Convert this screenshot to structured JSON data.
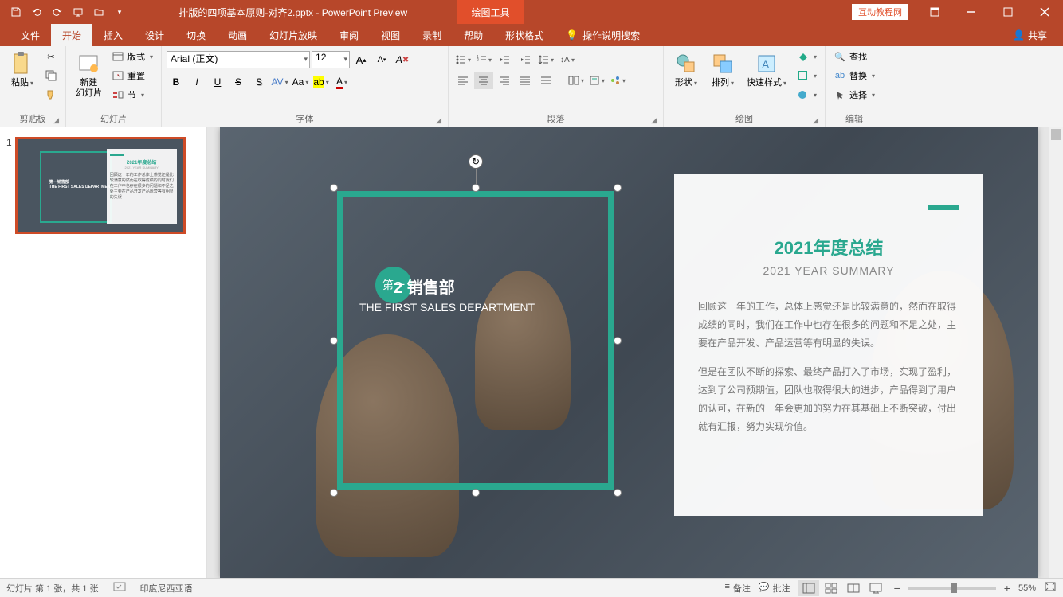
{
  "titlebar": {
    "docTitle": "排版的四项基本原则-对齐2.pptx - PowerPoint Preview",
    "contextTab": "绘图工具",
    "tutorialLink": "互动教程网"
  },
  "tabs": {
    "file": "文件",
    "home": "开始",
    "insert": "插入",
    "design": "设计",
    "transitions": "切换",
    "animations": "动画",
    "slideshow": "幻灯片放映",
    "review": "审阅",
    "view": "视图",
    "record": "录制",
    "help": "帮助",
    "shapeFormat": "形状格式",
    "tellMe": "操作说明搜索",
    "share": "共享"
  },
  "ribbon": {
    "clipboard": {
      "label": "剪贴板",
      "paste": "粘贴"
    },
    "slides": {
      "label": "幻灯片",
      "newSlide": "新建\n幻灯片",
      "layout": "版式",
      "reset": "重置",
      "section": "节"
    },
    "font": {
      "label": "字体",
      "fontName": "Arial (正文)",
      "fontSize": "12"
    },
    "paragraph": {
      "label": "段落"
    },
    "drawing": {
      "label": "绘图",
      "shapes": "形状",
      "arrange": "排列",
      "quickStyles": "快速样式"
    },
    "editing": {
      "label": "编辑",
      "find": "查找",
      "replace": "替换",
      "select": "选择"
    }
  },
  "slide": {
    "greenDot": "第一",
    "title1Suffix": "2 销售部",
    "subtitle1": "THE FIRST SALES DEPARTMENT",
    "cardTitle": "2021年度总结",
    "cardSubtitle": "2021 YEAR SUMMARY",
    "body1": "回顾这一年的工作，总体上感觉还是比较满意的，然而在取得成绩的同时，我们在工作中也存在很多的问题和不足之处，主要在产品开发、产品运营等有明显的失误。",
    "body2": "但是在团队不断的探索、最终产品打入了市场，实现了盈利，达到了公司预期值，团队也取得很大的进步，产品得到了用户的认可，在新的一年会更加的努力在其基础上不断突破，付出就有汇报，努力实现价值。"
  },
  "status": {
    "slideInfo": "幻灯片 第 1 张，共 1 张",
    "language": "印度尼西亚语",
    "notes": "备注",
    "comments": "批注",
    "zoom": "55%"
  }
}
